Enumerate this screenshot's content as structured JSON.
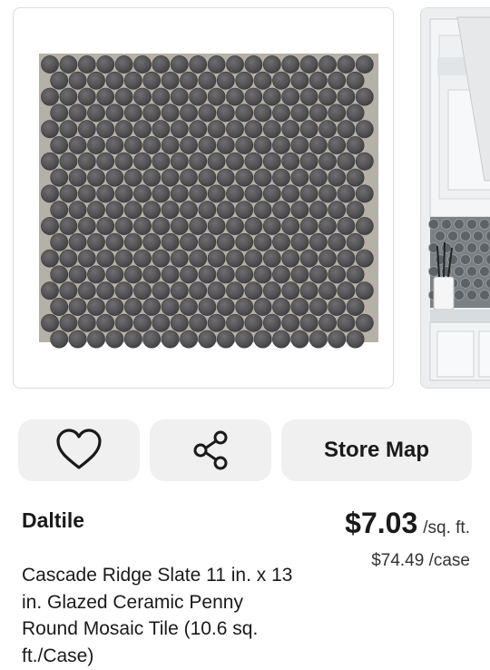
{
  "product": {
    "brand": "Daltile",
    "title": "Cascade Ridge Slate 11 in. x 13 in. Glazed Ceramic Penny Round Mosaic Tile (10.6 sq. ft./Case)",
    "price": "$7.03",
    "price_unit": "/sq. ft.",
    "price_case": "$74.49 /case"
  },
  "actions": {
    "favorite_icon": "heart-icon",
    "share_icon": "share-icon",
    "store_map_label": "Store Map"
  },
  "colors": {
    "tile": "#58585a",
    "grout": "#b5b0a8",
    "button_bg": "#f0f0f0",
    "card_border": "#dcdcdc"
  }
}
